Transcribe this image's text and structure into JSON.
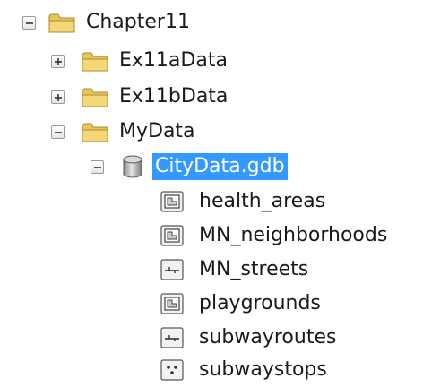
{
  "tree": {
    "root": {
      "label": "Chapter11",
      "icon": "folder-icon",
      "expanded": true,
      "children": [
        {
          "label": "Ex11aData",
          "icon": "folder-icon",
          "expanded": false
        },
        {
          "label": "Ex11bData",
          "icon": "folder-icon",
          "expanded": false
        },
        {
          "label": "MyData",
          "icon": "folder-icon",
          "expanded": true,
          "children": [
            {
              "label": "CityData.gdb",
              "icon": "geodatabase-icon",
              "expanded": true,
              "selected": true,
              "children": [
                {
                  "label": "health_areas",
                  "icon": "polygon-feature-class-icon"
                },
                {
                  "label": "MN_neighborhoods",
                  "icon": "polygon-feature-class-icon"
                },
                {
                  "label": "MN_streets",
                  "icon": "line-feature-class-icon"
                },
                {
                  "label": "playgrounds",
                  "icon": "polygon-feature-class-icon"
                },
                {
                  "label": "subwayroutes",
                  "icon": "line-feature-class-icon"
                },
                {
                  "label": "subwaystops",
                  "icon": "point-feature-class-icon"
                }
              ]
            }
          ]
        }
      ]
    }
  },
  "colors": {
    "selection": "#3399ff",
    "folder": "#e8c55a"
  }
}
